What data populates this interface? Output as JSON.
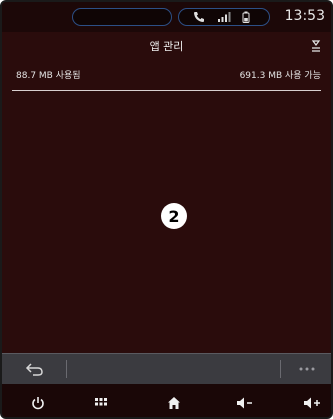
{
  "status_bar": {
    "time": "13:53",
    "icons": [
      "phone-icon",
      "signal-icon",
      "battery-icon"
    ]
  },
  "header": {
    "title": "앱 관리",
    "icon": "sort-icon"
  },
  "storage": {
    "used": "88.7 MB 사용됨",
    "available": "691.3 MB 사용 가능"
  },
  "callout": "2",
  "bottom_bar": {
    "back_icon": "back-icon",
    "more_icon": "more-icon"
  },
  "nav": {
    "items": [
      "power-icon",
      "apps-grid-icon",
      "home-icon",
      "volume-down-icon",
      "volume-up-icon"
    ]
  },
  "colors": {
    "background": "#2a0c0c",
    "accent": "#2c4f86"
  }
}
